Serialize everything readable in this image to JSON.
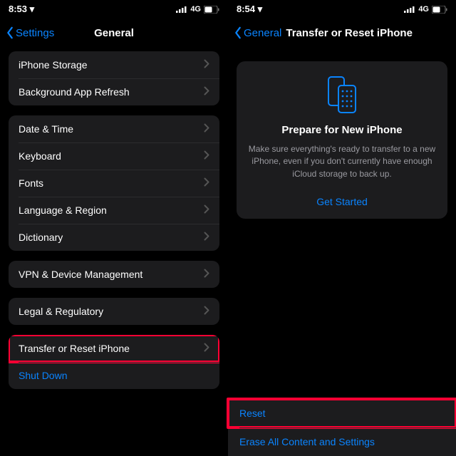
{
  "accent": "#0a84ff",
  "highlight_border": "#ff0033",
  "left": {
    "statusbar": {
      "time": "8:53 ▾",
      "network": "4G"
    },
    "nav": {
      "back_label": "Settings",
      "title": "General"
    },
    "group1": [
      {
        "label": "iPhone Storage"
      },
      {
        "label": "Background App Refresh"
      }
    ],
    "group2": [
      {
        "label": "Date & Time"
      },
      {
        "label": "Keyboard"
      },
      {
        "label": "Fonts"
      },
      {
        "label": "Language & Region"
      },
      {
        "label": "Dictionary"
      }
    ],
    "group3": [
      {
        "label": "VPN & Device Management"
      }
    ],
    "group4": [
      {
        "label": "Legal & Regulatory"
      }
    ],
    "group5": [
      {
        "label": "Transfer or Reset iPhone",
        "highlighted": true
      },
      {
        "label": "Shut Down",
        "blue": true,
        "no_chevron": true
      }
    ]
  },
  "right": {
    "statusbar": {
      "time": "8:54 ▾",
      "network": "4G"
    },
    "nav": {
      "back_label": "General",
      "title": "Transfer or Reset iPhone"
    },
    "promo": {
      "heading": "Prepare for New iPhone",
      "body": "Make sure everything's ready to transfer to a new iPhone, even if you don't currently have enough iCloud storage to back up.",
      "cta": "Get Started"
    },
    "bottom": [
      {
        "label": "Reset",
        "highlighted": true
      },
      {
        "label": "Erase All Content and Settings"
      }
    ]
  }
}
